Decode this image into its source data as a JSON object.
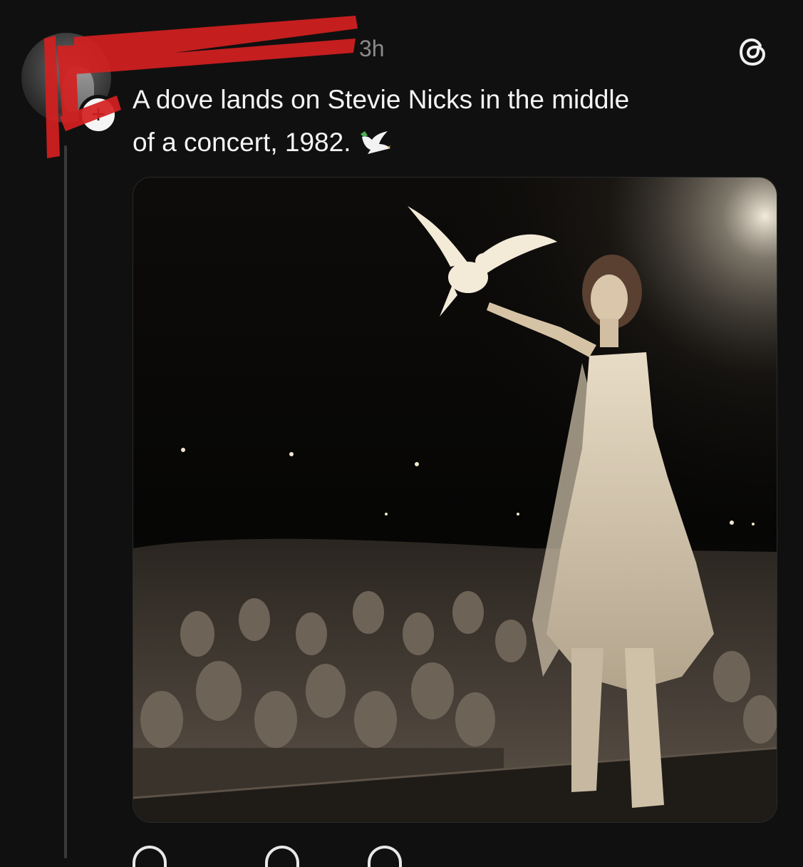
{
  "post": {
    "username": "",
    "timestamp": "3h",
    "caption_line1": "A dove lands on Stevie Nicks in the middle",
    "caption_line2": "of a concert, 1982.",
    "caption_emoji": "dove-of-peace-emoji",
    "follow_symbol": "+"
  },
  "icons": {
    "app_logo": "threads-logo-icon",
    "avatar": "user-avatar"
  },
  "colors": {
    "background": "#101010",
    "text": "#f3f3f3",
    "muted": "#8a8a8a",
    "redaction": "#d42020"
  }
}
